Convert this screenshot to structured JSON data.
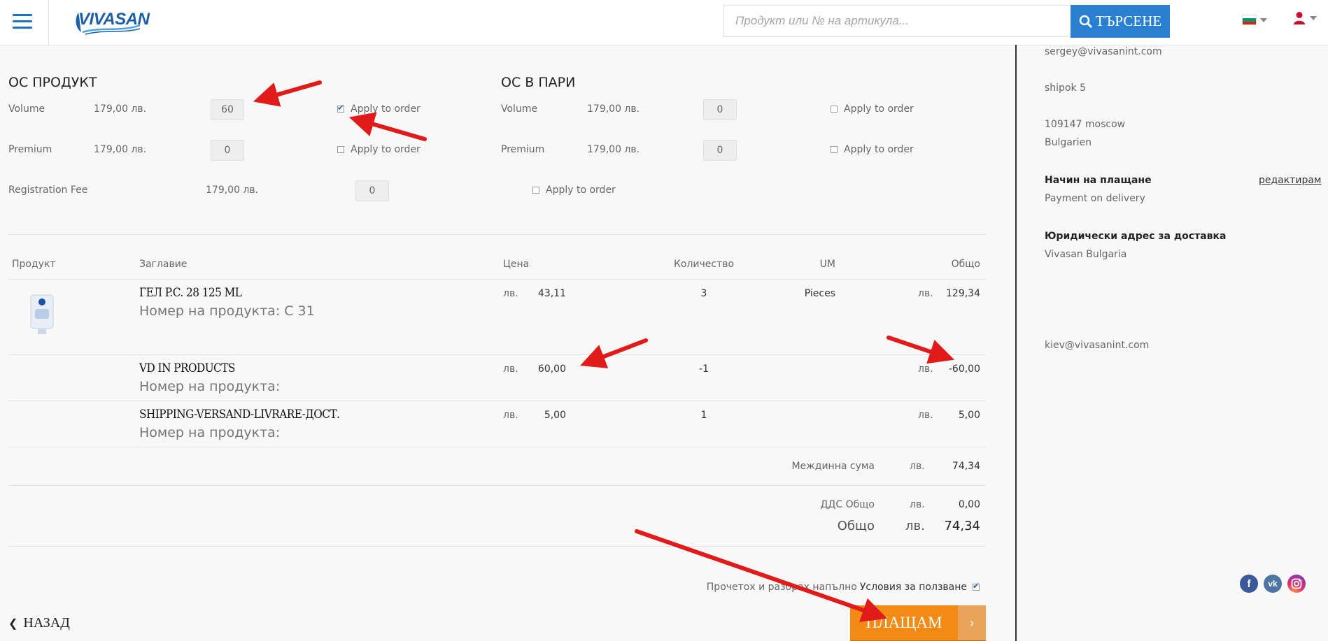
{
  "header": {
    "logo_text": "VIVASAN",
    "search_placeholder": "Продукт или № на артикула...",
    "search_button": "ТЪРСЕНЕ"
  },
  "oc_product": {
    "title": "ОС ПРОДУКТ",
    "rows": [
      {
        "label": "Volume",
        "amount": "179,00 лв.",
        "qty": "60",
        "apply_label": "Apply to order",
        "checked": true
      },
      {
        "label": "Premium",
        "amount": "179,00 лв.",
        "qty": "0",
        "apply_label": "Apply to order",
        "checked": false
      }
    ]
  },
  "oc_money": {
    "title": "ОС В ПАРИ",
    "rows": [
      {
        "label": "Volume",
        "amount": "179,00 лв.",
        "qty": "0",
        "apply_label": "Apply to order",
        "checked": false
      },
      {
        "label": "Premium",
        "amount": "179,00 лв.",
        "qty": "0",
        "apply_label": "Apply to order",
        "checked": false
      }
    ]
  },
  "registration": {
    "label": "Registration Fee",
    "amount": "179,00 лв.",
    "qty": "0",
    "apply_label": "Apply to order",
    "checked": false
  },
  "table": {
    "headers": {
      "product": "Продукт",
      "title": "Заглавие",
      "price": "Цена",
      "quantity": "Количество",
      "um": "UM",
      "total": "Общо"
    },
    "rows": [
      {
        "name": "ГЕЛ P.C. 28 125 ML",
        "code": "Номер на продукта: C 31",
        "currency": "лв.",
        "price": "43,11",
        "qty": "3",
        "um": "Pieces",
        "total_currency": "лв.",
        "total": "129,34"
      },
      {
        "name": "VD IN PRODUCTS",
        "code": "Номер на продукта:",
        "currency": "лв.",
        "price": "60,00",
        "qty": "-1",
        "um": "",
        "total_currency": "лв.",
        "total": "-60,00"
      },
      {
        "name": "SHIPPING-VERSAND-LIVRARE-ДОСТ.",
        "code": "Номер на продукта:",
        "currency": "лв.",
        "price": "5,00",
        "qty": "1",
        "um": "",
        "total_currency": "лв.",
        "total": "5,00"
      }
    ]
  },
  "totals": {
    "subtotal_label": "Междинна сума",
    "subtotal_currency": "лв.",
    "subtotal": "74,34",
    "vat_label": "ДДС Общо",
    "vat_currency": "лв.",
    "vat": "0,00",
    "total_label": "Общо",
    "total_currency": "лв.",
    "total": "74,34"
  },
  "terms": {
    "text": "Прочетох и разбрах напълно",
    "link": "Условия за ползване",
    "checked": true
  },
  "buttons": {
    "back": "НАЗАД",
    "pay": "ПЛАЩАМ"
  },
  "side": {
    "email": "sergey@vivasanint.com",
    "street": "shipok 5",
    "city": "109147 moscow",
    "country": "Bulgarien",
    "payment_head": "Начин на плащане",
    "edit": "редактирам",
    "payment_value": "Payment on delivery",
    "legal_head": "Юридически адрес за доставка",
    "legal_value": "Vivasan Bulgaria",
    "contact_email": "kiev@vivasanint.com"
  },
  "social": {
    "facebook": "f",
    "vk": "vk",
    "instagram": "instagram-icon"
  },
  "colors": {
    "accent": "#2a7fd0",
    "pay": "#f28a16",
    "arrow": "#e11a1a"
  }
}
